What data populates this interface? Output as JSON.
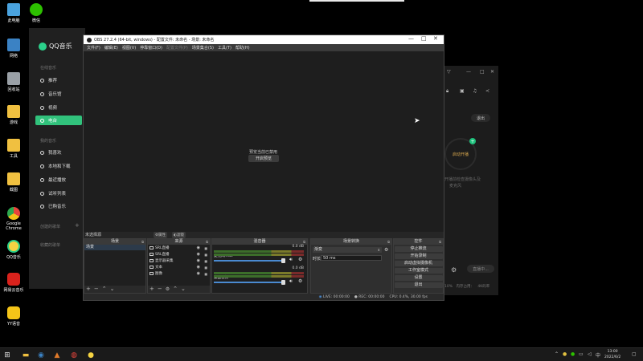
{
  "desktop": {
    "icons": [
      {
        "label": "此电脑",
        "color": "#4aa3df"
      },
      {
        "label": "微信",
        "color": "#2dc100"
      },
      {
        "label": "网络",
        "color": "#3b82c4"
      },
      {
        "label": "回收站",
        "color": "#9aa0a6"
      },
      {
        "label": "游戏",
        "color": "#f0c040"
      },
      {
        "label": "工具",
        "color": "#f0c040"
      },
      {
        "label": "截图",
        "color": "#f0c040"
      },
      {
        "label": "Google Chrome",
        "color": "#e8453c"
      },
      {
        "label": "QQ音乐",
        "color": "#f5d342"
      },
      {
        "label": "网易云音乐",
        "color": "#d9221c"
      },
      {
        "label": "YY语音",
        "color": "#f5c518"
      }
    ]
  },
  "qqmusic": {
    "brand": "QQ音乐",
    "section_online": "在线音乐",
    "online_items": [
      "推荐",
      "音乐馆",
      "视频",
      "电台"
    ],
    "section_mine": "我的音乐",
    "mine_items": [
      "我喜欢",
      "本地和下载",
      "最近播放",
      "试听列表",
      "已购音乐"
    ],
    "section_created": "创建的歌单",
    "section_favorited": "收藏的歌单",
    "active_item": "电台"
  },
  "right_panel": {
    "logout": "退出",
    "start_label": "启动开播",
    "hint_line1": "开播前检查摄像头及",
    "hint_line2": "麦克风",
    "status_pill": "直播中...",
    "bottom_left": "10%",
    "bottom_mid": "内存占用：",
    "bottom_right": "4K码率"
  },
  "obs": {
    "title": "OBS 27.2.4 (64-bit, windows) - 配置文件: 未命名 - 场景: 未命名",
    "menu": [
      "文件(F)",
      "编辑(E)",
      "视图(V)",
      "停靠窗口(D)",
      "配置文件(P)",
      "场景集合(S)",
      "工具(T)",
      "帮助(H)"
    ],
    "preview_text": "预览当前已禁用",
    "preview_button": "开启预览",
    "no_source": "未选择源",
    "props_button": "属性",
    "filters_button": "滤镜",
    "docks": {
      "scenes": "场景",
      "sources": "来源",
      "mixer": "混音器",
      "transitions": "场景转换",
      "controls": "控件"
    },
    "scenes": [
      "场景"
    ],
    "sources": [
      "SRL直播",
      "SRL直播",
      "显示器采集",
      "文本",
      "图像"
    ],
    "mixer": [
      {
        "name": "麦克风/Aux",
        "db": "0.0 dB"
      },
      {
        "name": "桌面音频",
        "db": "0.0 dB"
      }
    ],
    "transition": {
      "name": "渐变",
      "duration_label": "时长",
      "duration": "50 ms"
    },
    "controls": [
      "停止推流",
      "开始录制",
      "启动虚拟摄像机",
      "工作室模式",
      "设置",
      "退出"
    ],
    "status": {
      "live": "LIVE: 00:00:00",
      "rec": "REC: 00:00:00",
      "cpu": "CPU: 0.4%, 30.00 fps"
    }
  },
  "taskbar": {
    "time": "13:00",
    "date": "2022/6/2",
    "ime": "中"
  }
}
